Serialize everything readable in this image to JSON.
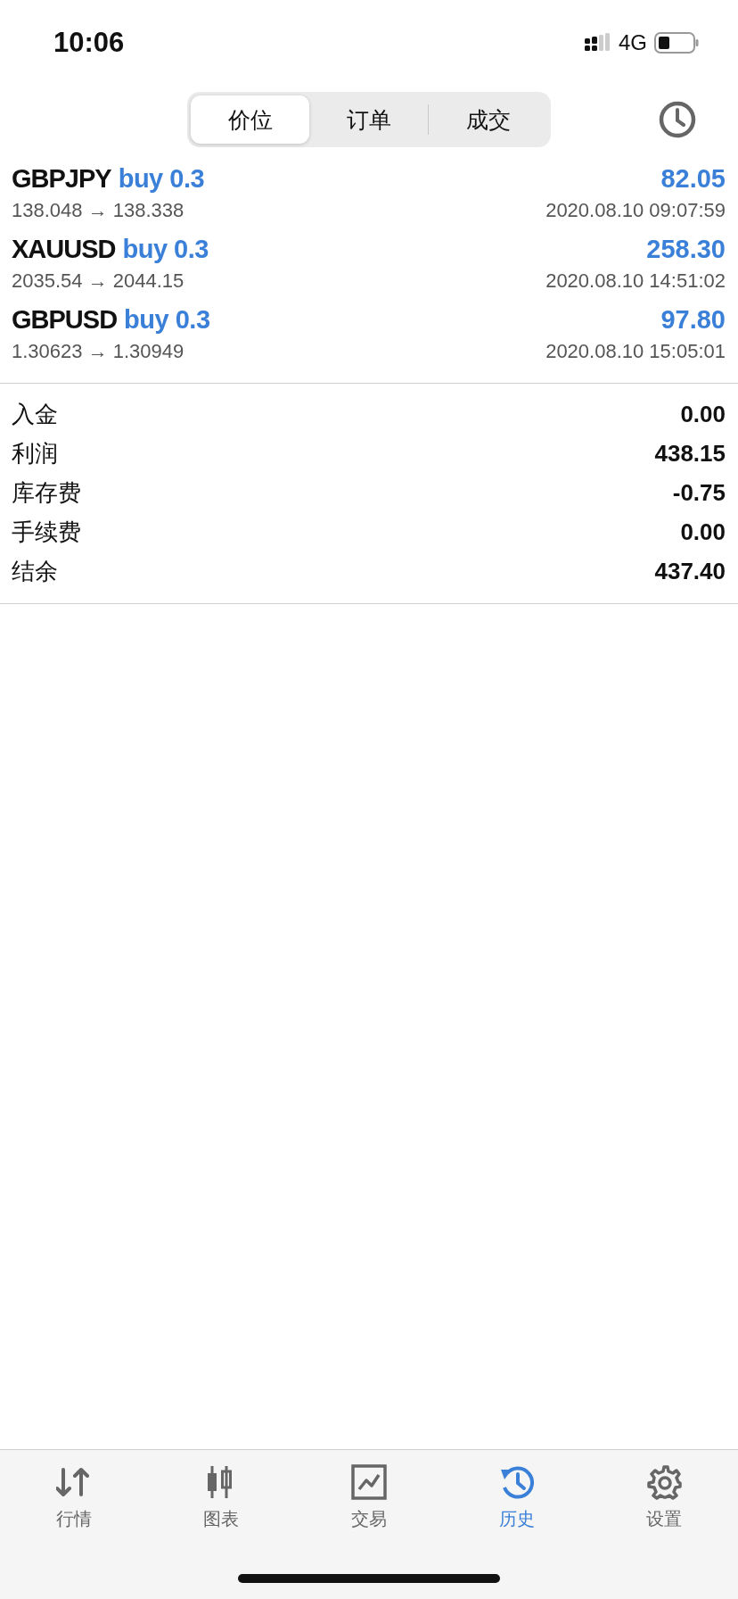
{
  "status_bar": {
    "time": "10:06",
    "network": "4G"
  },
  "segments": [
    {
      "label": "价位",
      "selected": true
    },
    {
      "label": "订单",
      "selected": false
    },
    {
      "label": "成交",
      "selected": false
    }
  ],
  "trades": [
    {
      "symbol": "GBPJPY",
      "order": "buy 0.3",
      "profit": "82.05",
      "prices": "138.048 → 138.338",
      "time": "2020.08.10 09:07:59"
    },
    {
      "symbol": "XAUUSD",
      "order": "buy 0.3",
      "profit": "258.30",
      "prices": "2035.54 → 2044.15",
      "time": "2020.08.10 14:51:02"
    },
    {
      "symbol": "GBPUSD",
      "order": "buy 0.3",
      "profit": "97.80",
      "prices": "1.30623 → 1.30949",
      "time": "2020.08.10 15:05:01"
    }
  ],
  "summary": [
    {
      "label": "入金",
      "value": "0.00"
    },
    {
      "label": "利润",
      "value": "438.15"
    },
    {
      "label": "库存费",
      "value": "-0.75"
    },
    {
      "label": "手续费",
      "value": "0.00"
    },
    {
      "label": "结余",
      "value": "437.40"
    }
  ],
  "tab_bar": [
    {
      "kind": "quotes",
      "label": "行情",
      "selected": false
    },
    {
      "kind": "chart",
      "label": "图表",
      "selected": false
    },
    {
      "kind": "trade",
      "label": "交易",
      "selected": false
    },
    {
      "kind": "history",
      "label": "历史",
      "selected": true
    },
    {
      "kind": "settings",
      "label": "设置",
      "selected": false
    }
  ]
}
